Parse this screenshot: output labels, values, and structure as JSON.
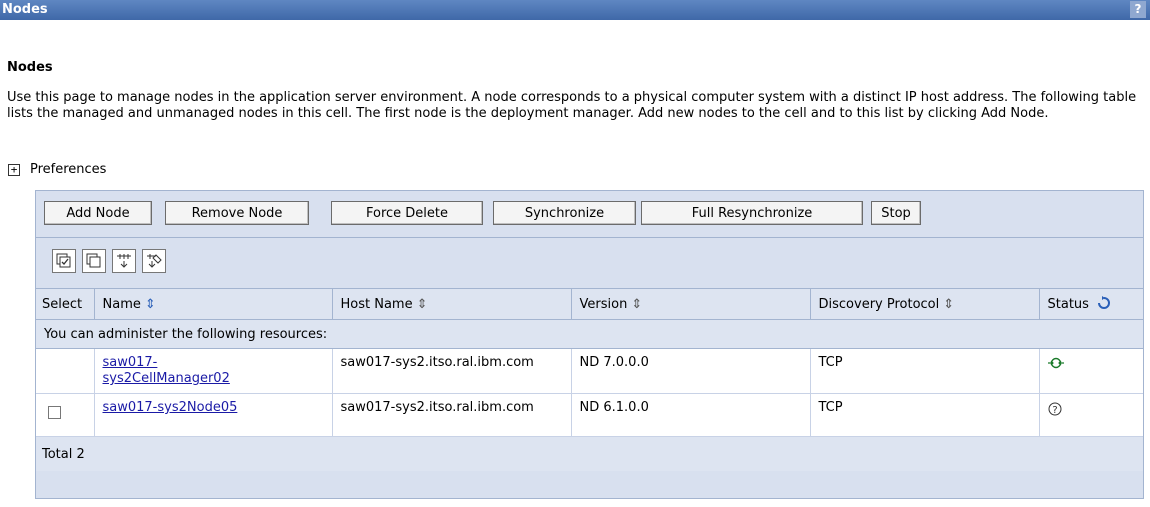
{
  "titlebar": {
    "title": "Nodes",
    "help": "?"
  },
  "page": {
    "heading": "Nodes",
    "description": "Use this page to manage nodes in the application server environment. A node corresponds to a physical computer system with a distinct IP host address. The following table lists the managed and unmanaged nodes in this cell. The first node is the deployment manager. Add new nodes to the cell and to this list by clicking Add Node."
  },
  "preferences": {
    "label": "Preferences",
    "expander": "+"
  },
  "buttons": {
    "add_node": "Add Node",
    "remove_node": "Remove Node",
    "force_delete": "Force Delete",
    "synchronize": "Synchronize",
    "full_resync": "Full Resynchronize",
    "stop": "Stop"
  },
  "toolbar_icons": [
    "select-all-icon",
    "deselect-all-icon",
    "show-filter-icon",
    "clear-filter-icon"
  ],
  "table": {
    "headers": {
      "select": "Select",
      "name": "Name",
      "host": "Host Name",
      "version": "Version",
      "protocol": "Discovery Protocol",
      "status": "Status"
    },
    "info_row": "You can administer the following resources:",
    "rows": [
      {
        "name": "saw017-sys2CellManager02",
        "host": "saw017-sys2.itso.ral.ibm.com",
        "version": "ND 7.0.0.0",
        "protocol": "TCP",
        "status_icon": "synchronized-icon",
        "selectable": false
      },
      {
        "name": "saw017-sys2Node05",
        "host": "saw017-sys2.itso.ral.ibm.com",
        "version": "ND 6.1.0.0",
        "protocol": "TCP",
        "status_icon": "unknown-status-icon",
        "selectable": true
      }
    ],
    "total": "Total 2"
  },
  "colors": {
    "titlebar": "#4a73b4",
    "panel": "#d8e0ef",
    "link": "#1a1aa6"
  }
}
